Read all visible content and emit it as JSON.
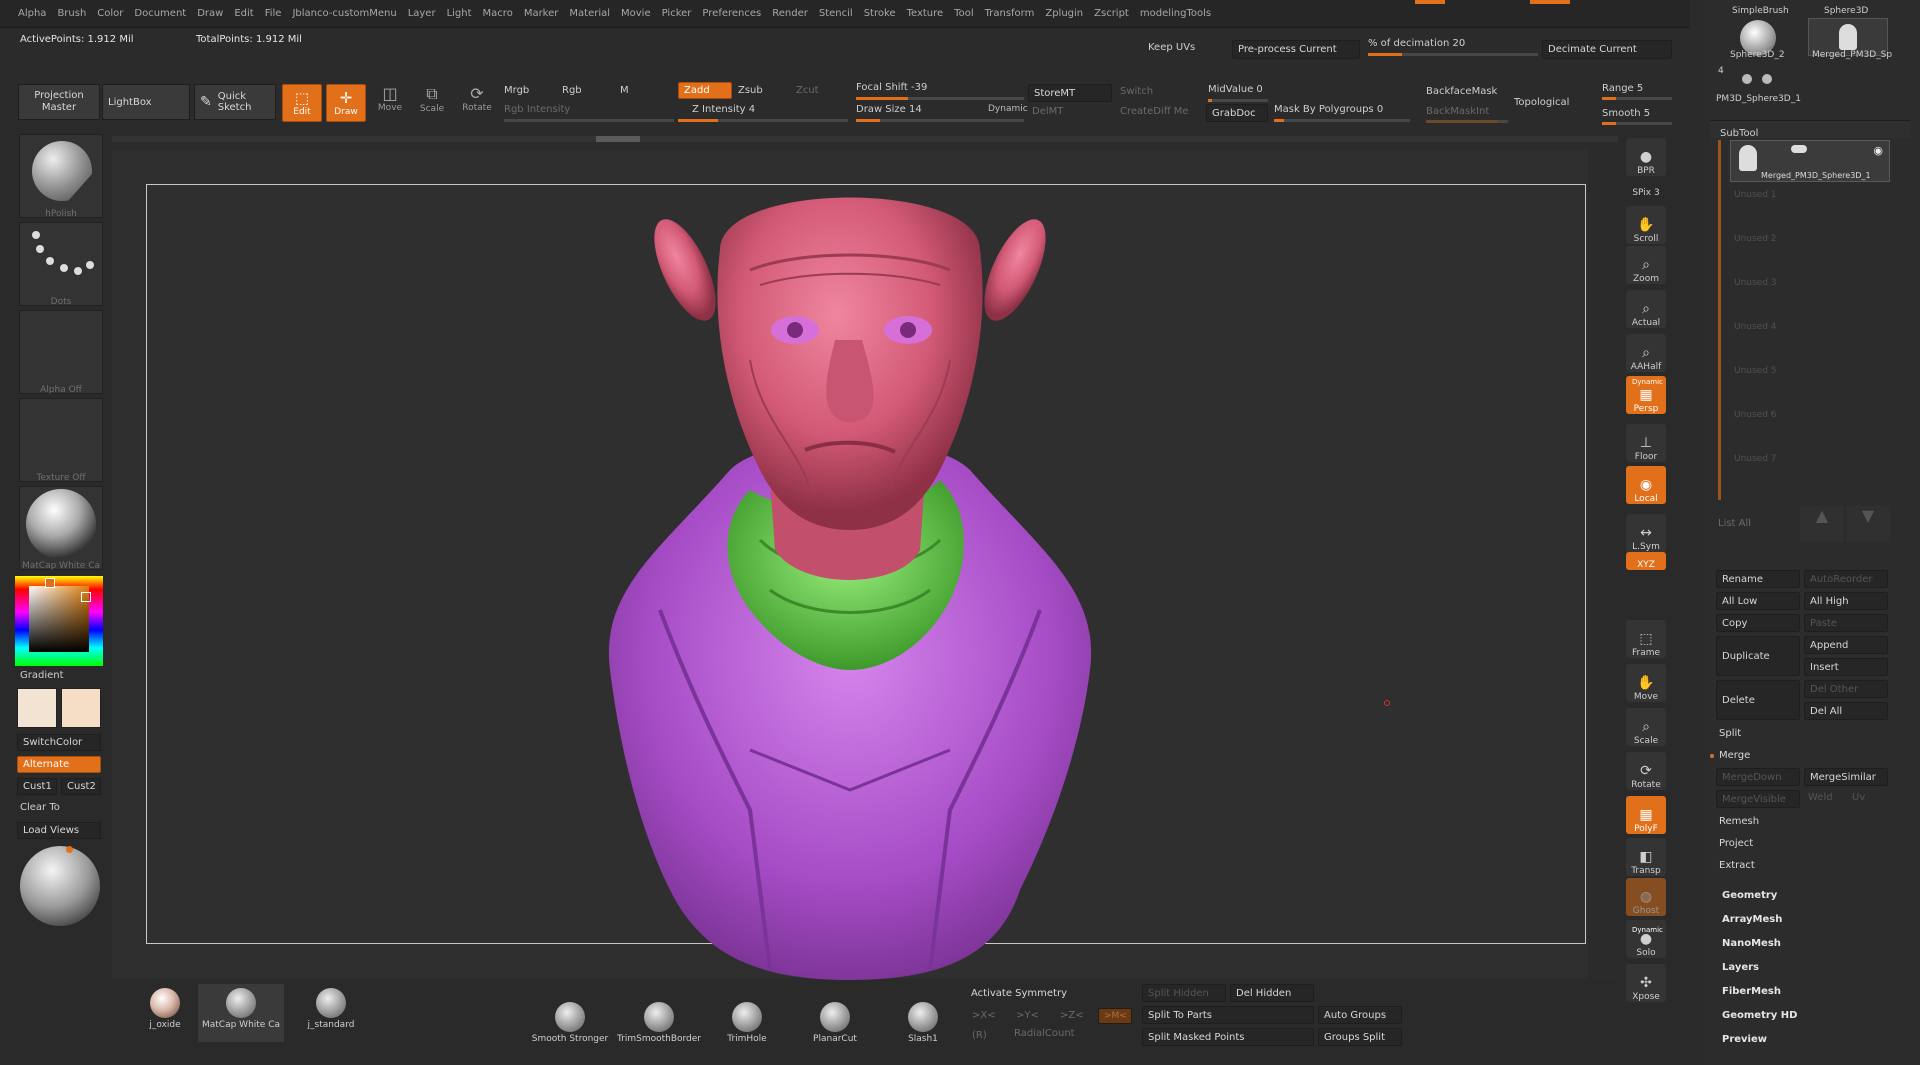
{
  "menu": [
    "Alpha",
    "Brush",
    "Color",
    "Document",
    "Draw",
    "Edit",
    "File",
    "Jblanco-customMenu",
    "Layer",
    "Light",
    "Macro",
    "Marker",
    "Material",
    "Movie",
    "Picker",
    "Preferences",
    "Render",
    "Stencil",
    "Stroke",
    "Texture",
    "Tool",
    "Transform",
    "Zplugin",
    "Zscript",
    "modelingTools"
  ],
  "status": {
    "active_points": "ActivePoints: 1.912 Mil",
    "total_points": "TotalPoints: 1.912 Mil"
  },
  "decimation": {
    "keep_uvs": "Keep UVs",
    "preprocess": "Pre-process Current",
    "percent": "% of decimation 20",
    "decimate": "Decimate Current"
  },
  "toolbar": {
    "projection_master": "Projection Master",
    "lightbox": "LightBox",
    "quick_sketch": "Quick Sketch",
    "edit": "Edit",
    "draw": "Draw",
    "move": "Move",
    "scale": "Scale",
    "rotate": "Rotate",
    "mrgb": "Mrgb",
    "rgb": "Rgb",
    "m": "M",
    "rgb_intensity": "Rgb Intensity",
    "zadd": "Zadd",
    "zsub": "Zsub",
    "zcut": "Zcut",
    "z_intensity": "Z Intensity 4",
    "focal_shift": "Focal Shift -39",
    "draw_size": "Draw Size 14",
    "dynamic": "Dynamic",
    "storemt": "StoreMT",
    "delmt": "DelMT",
    "switch": "Switch",
    "createdif": "CreateDiff Me",
    "midvalue": "MidValue 0",
    "grabdoc": "GrabDoc",
    "mask_polygroups": "Mask By Polygroups 0",
    "backfacemask": "BackfaceMask",
    "backmaskint": "BackMaskInt",
    "topological": "Topological",
    "range": "Range 5",
    "smooth": "Smooth 5"
  },
  "left_shelf": {
    "brush": "hPolish",
    "stroke": "Dots",
    "alpha": "Alpha Off",
    "texture": "Texture Off",
    "material": "MatCap White Ca",
    "gradient": "Gradient",
    "switch_color": "SwitchColor",
    "alternate": "Alternate",
    "cust1": "Cust1",
    "cust2": "Cust2",
    "clear_to": "Clear To",
    "load_views": "Load Views"
  },
  "right_shelf": [
    "BPR",
    "SPix 3",
    "Scroll",
    "Zoom",
    "Actual",
    "AAHalf",
    "Persp",
    "Floor",
    "Local",
    "L.Sym",
    "XYZ",
    "Frame",
    "Move",
    "Scale",
    "Rotate",
    "PolyF",
    "Transp",
    "Ghost",
    "Solo",
    "Xpose"
  ],
  "right_shelf_labels": {
    "dynamic": "Dynamic"
  },
  "tool_palette": {
    "simple_brush": "SimpleBrush",
    "sphere3d": "Sphere3D",
    "sphere3d_2": "Sphere3D_2",
    "merged": "Merged_PM3D_Sp",
    "count": "4",
    "pm3d_sphere": "PM3D_Sphere3D_1"
  },
  "subtool": {
    "title": "SubTool",
    "active": "Merged_PM3D_Sphere3D_1",
    "unused": [
      "Unused 1",
      "Unused 2",
      "Unused 3",
      "Unused 4",
      "Unused 5",
      "Unused 6",
      "Unused 7"
    ],
    "list_all": "List All",
    "rename": "Rename",
    "auto_reorder": "AutoReorder",
    "all_low": "All Low",
    "all_high": "All High",
    "copy": "Copy",
    "paste": "Paste",
    "append": "Append",
    "duplicate": "Duplicate",
    "insert": "Insert",
    "del_other": "Del Other",
    "delete": "Delete",
    "del_all": "Del All",
    "split": "Split",
    "merge": "Merge",
    "merge_down": "MergeDown",
    "merge_similar": "MergeSimilar",
    "merge_visible": "MergeVisible",
    "weld": "Weld",
    "uv": "Uv",
    "remesh": "Remesh",
    "project": "Project",
    "extract": "Extract"
  },
  "palettes": [
    "Geometry",
    "ArrayMesh",
    "NanoMesh",
    "Layers",
    "FiberMesh",
    "Geometry HD",
    "Preview"
  ],
  "bottom": {
    "materials": [
      "j_oxide",
      "MatCap White Ca",
      "j_standard"
    ],
    "brushes": [
      "Smooth Stronger",
      "TrimSmoothBorder",
      "TrimHole",
      "PlanarCut",
      "Slash1"
    ],
    "activate_symmetry": "Activate Symmetry",
    "x": ">X<",
    "y": ">Y<",
    "z": ">Z<",
    "m": ">M<",
    "r": "(R)",
    "radial": "RadialCount",
    "split_hidden": "Split Hidden",
    "del_hidden": "Del Hidden",
    "split_to_parts": "Split To Parts",
    "auto_groups": "Auto Groups",
    "split_masked": "Split Masked Points",
    "groups_split": "Groups Split"
  },
  "colors": {
    "accent": "#e2701a",
    "skin": "#d6607c",
    "jacket": "#b45bd0",
    "scarf": "#6fd659",
    "canvas": "#2f2f2f"
  }
}
